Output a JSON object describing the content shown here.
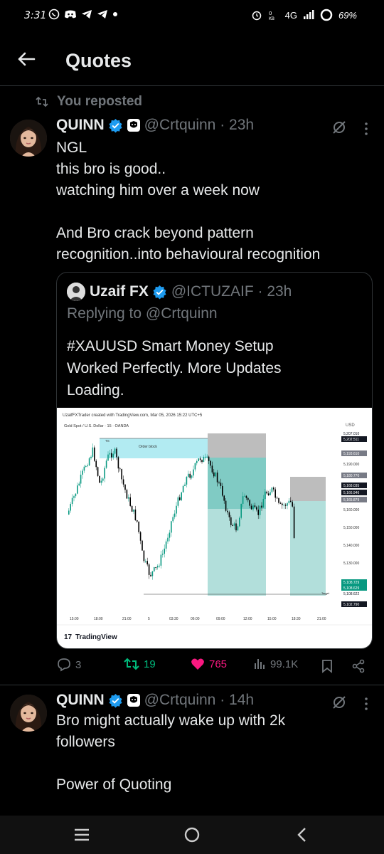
{
  "status_bar": {
    "time": "3:31",
    "network": "4G",
    "battery": "69%"
  },
  "header": {
    "title": "Quotes"
  },
  "repost": {
    "label": "You reposted"
  },
  "post1": {
    "display_name": "QUINN",
    "handle_time": "@Crtquinn · 23h",
    "text": "NGL\nthis bro is good..\nwatching him over a week now\n\nAnd Bro crack beyond pattern\nrecognition..into behavioural recognition",
    "quote": {
      "display_name": "Uzaif FX",
      "handle_time": "@ICTUZAIF · 23h",
      "replying_prefix": "Replying to ",
      "replying_to": "@Crtquinn",
      "text": "#XAUUSD Smart Money Setup\nWorked Perfectly. More Updates\nLoading."
    },
    "actions": {
      "replies": "3",
      "reposts": "19",
      "likes": "765",
      "views": "99.1K"
    }
  },
  "post2": {
    "display_name": "QUINN",
    "handle_time": "@Crtquinn · 14h",
    "text": "Bro might actually wake up with 2k\nfollowers\n\nPower of Quoting"
  },
  "chart_data": {
    "type": "candlestick",
    "header": "UzaifFXTrader created with TradingView.com, Mar 05, 2026 15:22 UTC+5",
    "subheader": "Gold Spot / U.S. Dollar · 15 · OANDA",
    "currency": "USD",
    "annotations": [
      "TS",
      "Order block",
      "Target"
    ],
    "price_ticks": [
      "5,190.000",
      "5,160.000",
      "5,150.000",
      "5,140.000",
      "5,130.000"
    ],
    "price_labels": [
      "5,207.010",
      "5,202.511",
      "5,193.610",
      "5,180.770",
      "5,168.035",
      "5,166.946",
      "5,165.879",
      "5,108.729",
      "5,108.629",
      "5,108.622",
      "5,102.790"
    ],
    "countdown": "07:10",
    "time_ticks": [
      "15:00",
      "18:00",
      "21:00",
      "5",
      "03:30",
      "06:00",
      "09:00",
      "12:00",
      "15:00",
      "18:30",
      "21:00"
    ],
    "logo_text": "TradingView",
    "colors": {
      "up": "#089981",
      "down": "#000000",
      "zone_order_block": "#b2ebf2",
      "zone_target": "#80cbc4"
    }
  }
}
